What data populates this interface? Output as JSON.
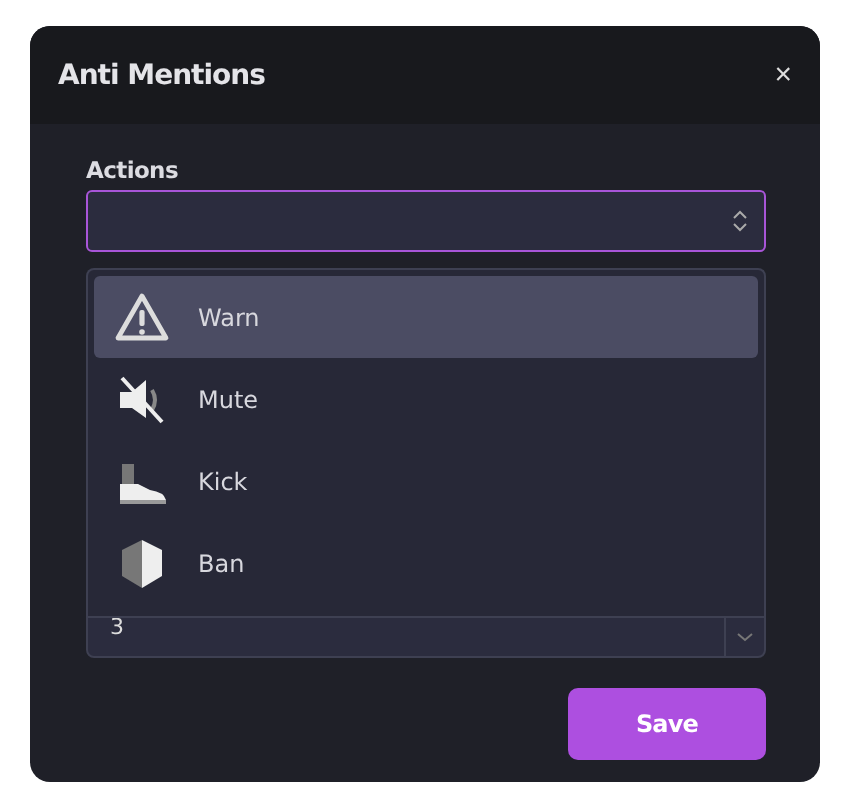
{
  "dialog": {
    "title": "Anti Mentions",
    "close": "×"
  },
  "actions_field": {
    "label": "Actions"
  },
  "menu": {
    "items": [
      {
        "label": "Warn",
        "kind": "warn",
        "highlighted": true
      },
      {
        "label": "Mute",
        "kind": "mute",
        "highlighted": false
      },
      {
        "label": "Kick",
        "kind": "kick",
        "highlighted": false
      },
      {
        "label": "Ban",
        "kind": "ban",
        "highlighted": false
      }
    ]
  },
  "number_field": {
    "value": "3"
  },
  "buttons": {
    "save": "Save"
  }
}
